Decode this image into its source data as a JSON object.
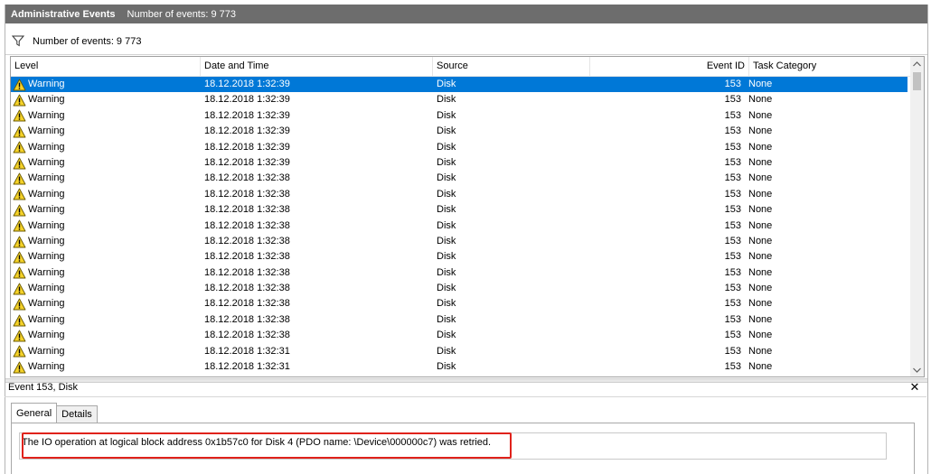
{
  "window": {
    "title": "Administrative Events",
    "title_count": "Number of events: 9 773"
  },
  "filter": {
    "icon": "filter-icon",
    "count_label": "Number of events: 9 773"
  },
  "columns": {
    "level": "Level",
    "date": "Date and Time",
    "source": "Source",
    "event_id": "Event ID",
    "category": "Task Category"
  },
  "events": [
    {
      "level": "Warning",
      "date": "18.12.2018 1:32:39",
      "source": "Disk",
      "id": "153",
      "category": "None",
      "selected": true
    },
    {
      "level": "Warning",
      "date": "18.12.2018 1:32:39",
      "source": "Disk",
      "id": "153",
      "category": "None"
    },
    {
      "level": "Warning",
      "date": "18.12.2018 1:32:39",
      "source": "Disk",
      "id": "153",
      "category": "None"
    },
    {
      "level": "Warning",
      "date": "18.12.2018 1:32:39",
      "source": "Disk",
      "id": "153",
      "category": "None"
    },
    {
      "level": "Warning",
      "date": "18.12.2018 1:32:39",
      "source": "Disk",
      "id": "153",
      "category": "None"
    },
    {
      "level": "Warning",
      "date": "18.12.2018 1:32:39",
      "source": "Disk",
      "id": "153",
      "category": "None"
    },
    {
      "level": "Warning",
      "date": "18.12.2018 1:32:38",
      "source": "Disk",
      "id": "153",
      "category": "None"
    },
    {
      "level": "Warning",
      "date": "18.12.2018 1:32:38",
      "source": "Disk",
      "id": "153",
      "category": "None"
    },
    {
      "level": "Warning",
      "date": "18.12.2018 1:32:38",
      "source": "Disk",
      "id": "153",
      "category": "None"
    },
    {
      "level": "Warning",
      "date": "18.12.2018 1:32:38",
      "source": "Disk",
      "id": "153",
      "category": "None"
    },
    {
      "level": "Warning",
      "date": "18.12.2018 1:32:38",
      "source": "Disk",
      "id": "153",
      "category": "None"
    },
    {
      "level": "Warning",
      "date": "18.12.2018 1:32:38",
      "source": "Disk",
      "id": "153",
      "category": "None"
    },
    {
      "level": "Warning",
      "date": "18.12.2018 1:32:38",
      "source": "Disk",
      "id": "153",
      "category": "None"
    },
    {
      "level": "Warning",
      "date": "18.12.2018 1:32:38",
      "source": "Disk",
      "id": "153",
      "category": "None"
    },
    {
      "level": "Warning",
      "date": "18.12.2018 1:32:38",
      "source": "Disk",
      "id": "153",
      "category": "None"
    },
    {
      "level": "Warning",
      "date": "18.12.2018 1:32:38",
      "source": "Disk",
      "id": "153",
      "category": "None"
    },
    {
      "level": "Warning",
      "date": "18.12.2018 1:32:38",
      "source": "Disk",
      "id": "153",
      "category": "None"
    },
    {
      "level": "Warning",
      "date": "18.12.2018 1:32:31",
      "source": "Disk",
      "id": "153",
      "category": "None"
    },
    {
      "level": "Warning",
      "date": "18.12.2018 1:32:31",
      "source": "Disk",
      "id": "153",
      "category": "None"
    }
  ],
  "detail": {
    "header": "Event 153, Disk",
    "tabs": {
      "general": "General",
      "details": "Details"
    },
    "message": "The IO operation at logical block address 0x1b57c0 for Disk 4 (PDO name: \\Device\\000000c7) was retried."
  },
  "colors": {
    "titlebar": "#6d6d6d",
    "selection": "#0078d7",
    "warning_icon": "#f5d228",
    "highlight": "#e0221b"
  }
}
